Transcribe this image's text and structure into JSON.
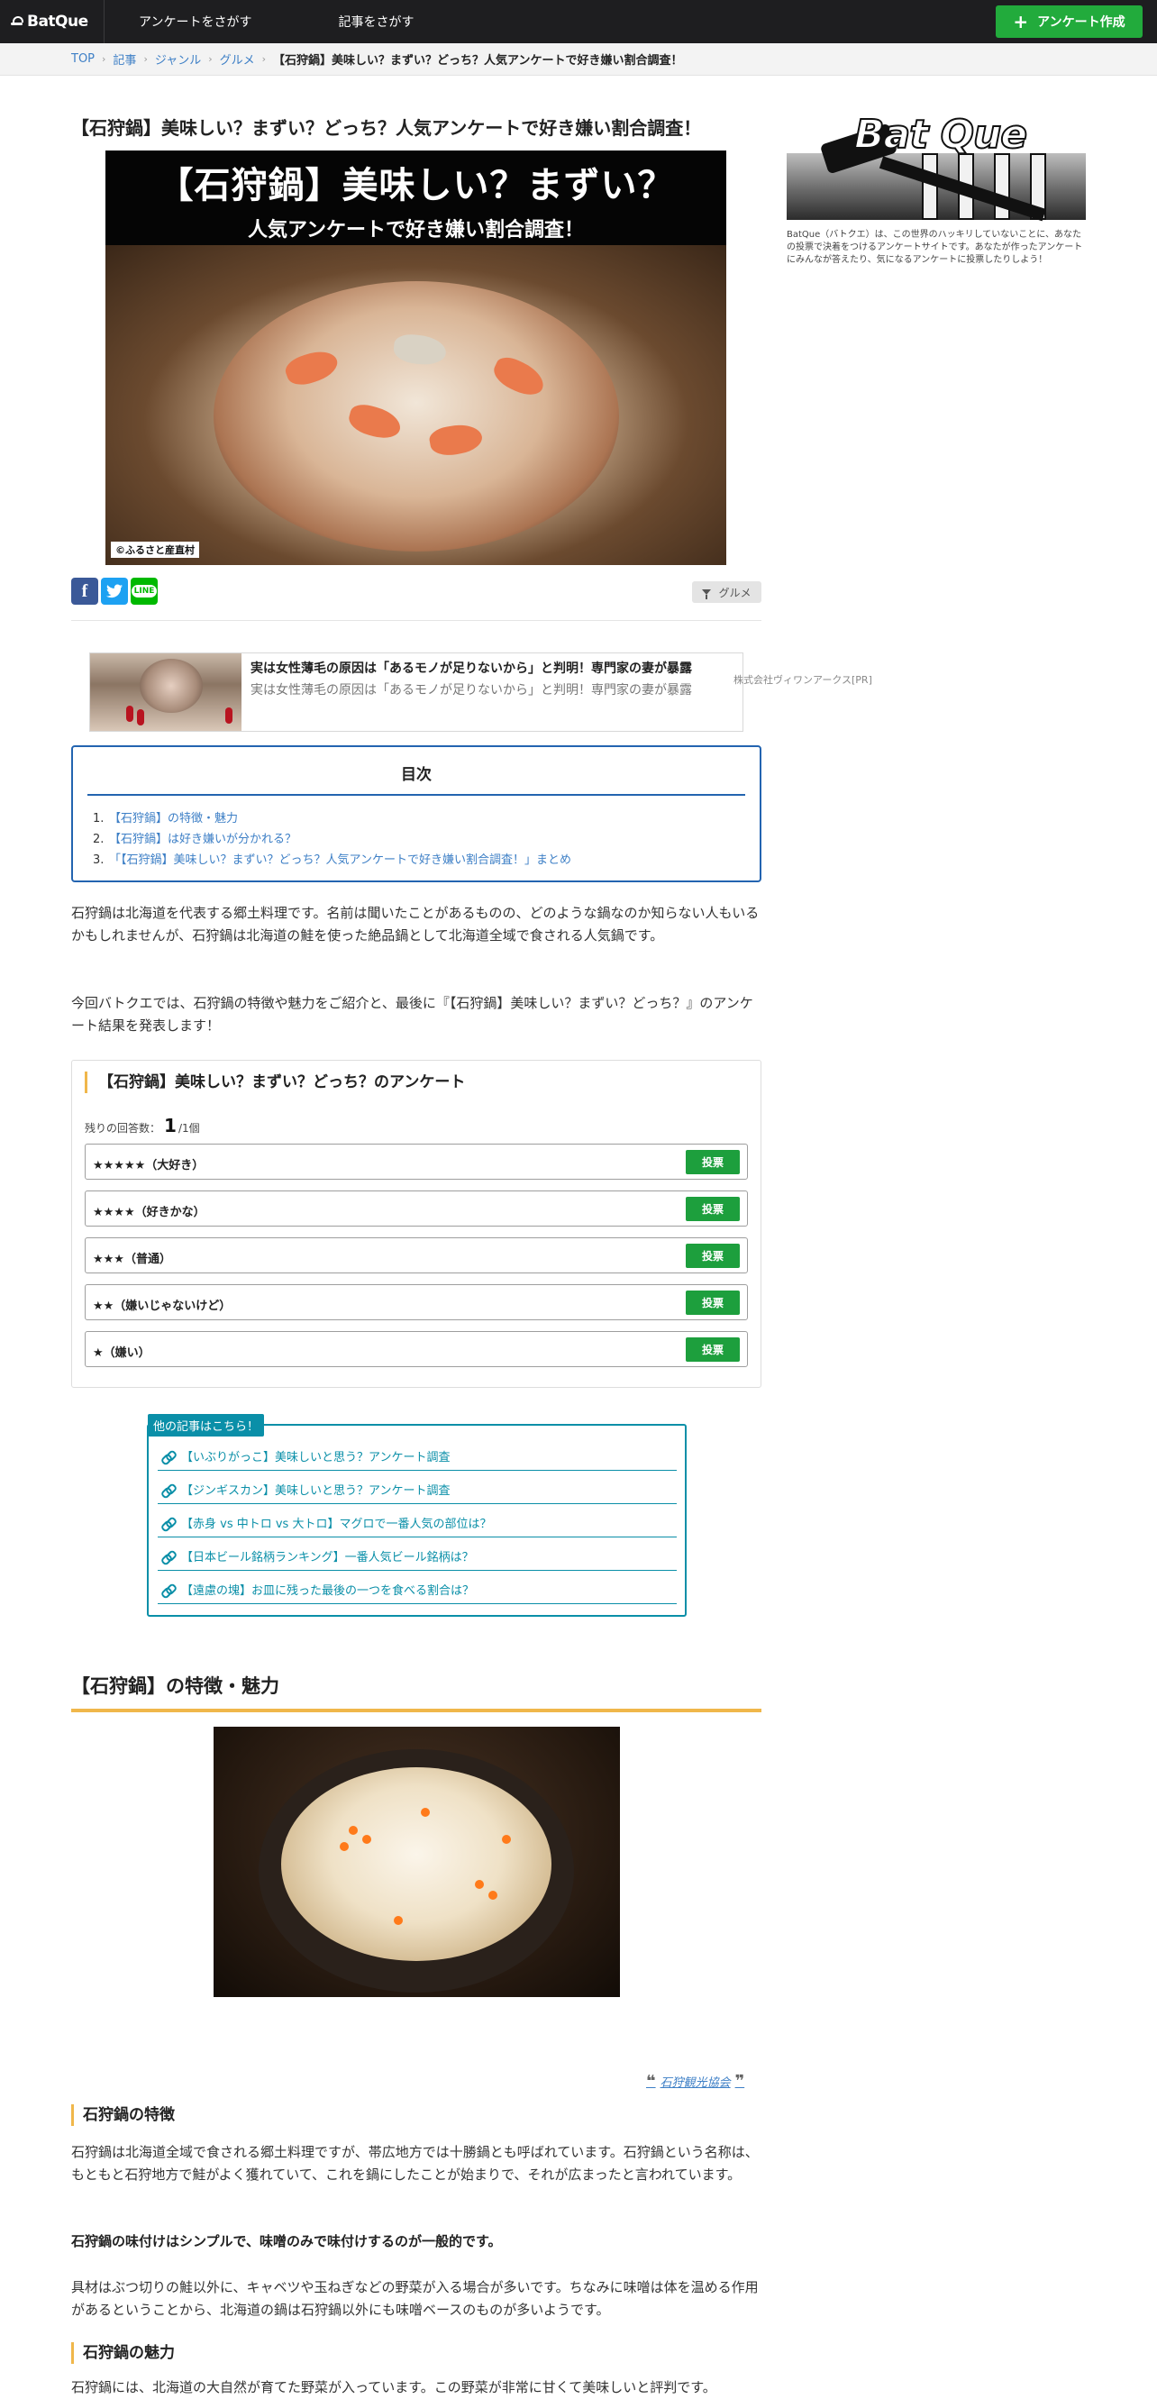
{
  "header": {
    "logo": "BatQue",
    "nav": [
      "アンケートをさがす",
      "記事をさがす"
    ],
    "create_button": "アンケート作成"
  },
  "breadcrumb": {
    "items": [
      "TOP",
      "記事",
      "ジャンル",
      "グルメ"
    ],
    "current": "【石狩鍋】美味しい？まずい？どっち？人気アンケートで好き嫌い割合調査！"
  },
  "article": {
    "title": "【石狩鍋】美味しい？まずい？どっち？人気アンケートで好き嫌い割合調査！",
    "hero_line1": "【石狩鍋】美味しい？まずい？",
    "hero_line2": "人気アンケートで好き嫌い割合調査！",
    "hero_credit": "©ふるさと産直村",
    "genre_tag": "グルメ"
  },
  "share": {
    "facebook": "f",
    "line": "LINE"
  },
  "ad": {
    "title": "実は女性薄毛の原因は「あるモノが足りないから」と判明！専門家の妻が暴露",
    "desc": "実は女性薄毛の原因は「あるモノが足りないから」と判明！専門家の妻が暴露",
    "sponsor": "株式会社ヴィワンアークス[PR]"
  },
  "toc": {
    "title": "目次",
    "items": [
      {
        "num": "1.",
        "label": "【石狩鍋】の特徴・魅力"
      },
      {
        "num": "2.",
        "label": "【石狩鍋】は好き嫌いが分かれる？"
      },
      {
        "num": "3.",
        "label": "「【石狩鍋】美味しい？まずい？どっち？人気アンケートで好き嫌い割合調査！」まとめ"
      }
    ]
  },
  "intro": {
    "p1": "石狩鍋は北海道を代表する郷土料理です。名前は聞いたことがあるものの、どのような鍋なのか知らない人もいるかもしれませんが、石狩鍋は北海道の鮭を使った絶品鍋として北海道全域で食される人気鍋です。",
    "p2": "今回バトクエでは、石狩鍋の特徴や魅力をご紹介と、最後に『【石狩鍋】美味しい？まずい？どっち？』のアンケート結果を発表します！"
  },
  "poll": {
    "title": "【石狩鍋】美味しい？まずい？どっち？のアンケート",
    "remaining_label": "残りの回答数：",
    "remaining": "1",
    "remaining_total": "/1個",
    "vote_label": "投票",
    "options": [
      "★★★★★（大好き）",
      "★★★★（好きかな）",
      "★★★（普通）",
      "★★（嫌いじゃないけど）",
      "★（嫌い）"
    ]
  },
  "related": {
    "tag": "他の記事はこちら！",
    "items": [
      "【いぶりがっこ】美味しいと思う？アンケート調査",
      "【ジンギスカン】美味しいと思う？アンケート調査",
      "【赤身 vs 中トロ vs 大トロ】マグロで一番人気の部位は？",
      "【日本ビール銘柄ランキング】一番人気ビール銘柄は？",
      "【遠慮の塊】お皿に残った最後の一つを食べる割合は？"
    ]
  },
  "section1": {
    "heading": "【石狩鍋】の特徴・魅力",
    "photo_credit": "石狩観光協会",
    "sub1": "石狩鍋の特徴",
    "p1": "石狩鍋は北海道全域で食される郷土料理ですが、帯広地方では十勝鍋とも呼ばれています。石狩鍋という名称は、もともと石狩地方で鮭がよく獲れていて、これを鍋にしたことが始まりで、それが広まったと言われています。",
    "p2_bold": "石狩鍋の味付けはシンプルで、味噌のみで味付けするのが一般的です。",
    "p3": "具材はぶつ切りの鮭以外に、キャベツや玉ねぎなどの野菜が入る場合が多いです。ちなみに味噌は体を温める作用があるということから、北海道の鍋は石狩鍋以外にも味噌ベースのものが多いようです。",
    "sub2": "石狩鍋の魅力",
    "p4": "石狩鍋には、北海道の大自然が育てた野菜が入っています。この野菜が非常に甘くて美味しいと評判です。"
  },
  "sidebar": {
    "logo_text": "Bat Que",
    "desc": "BatQue（バトクエ）は、この世界のハッキリしていないことに、あなたの投票で決着をつけるアンケートサイトです。あなたが作ったアンケートにみんなが答えたり、気になるアンケートに投票したりしよう！"
  }
}
